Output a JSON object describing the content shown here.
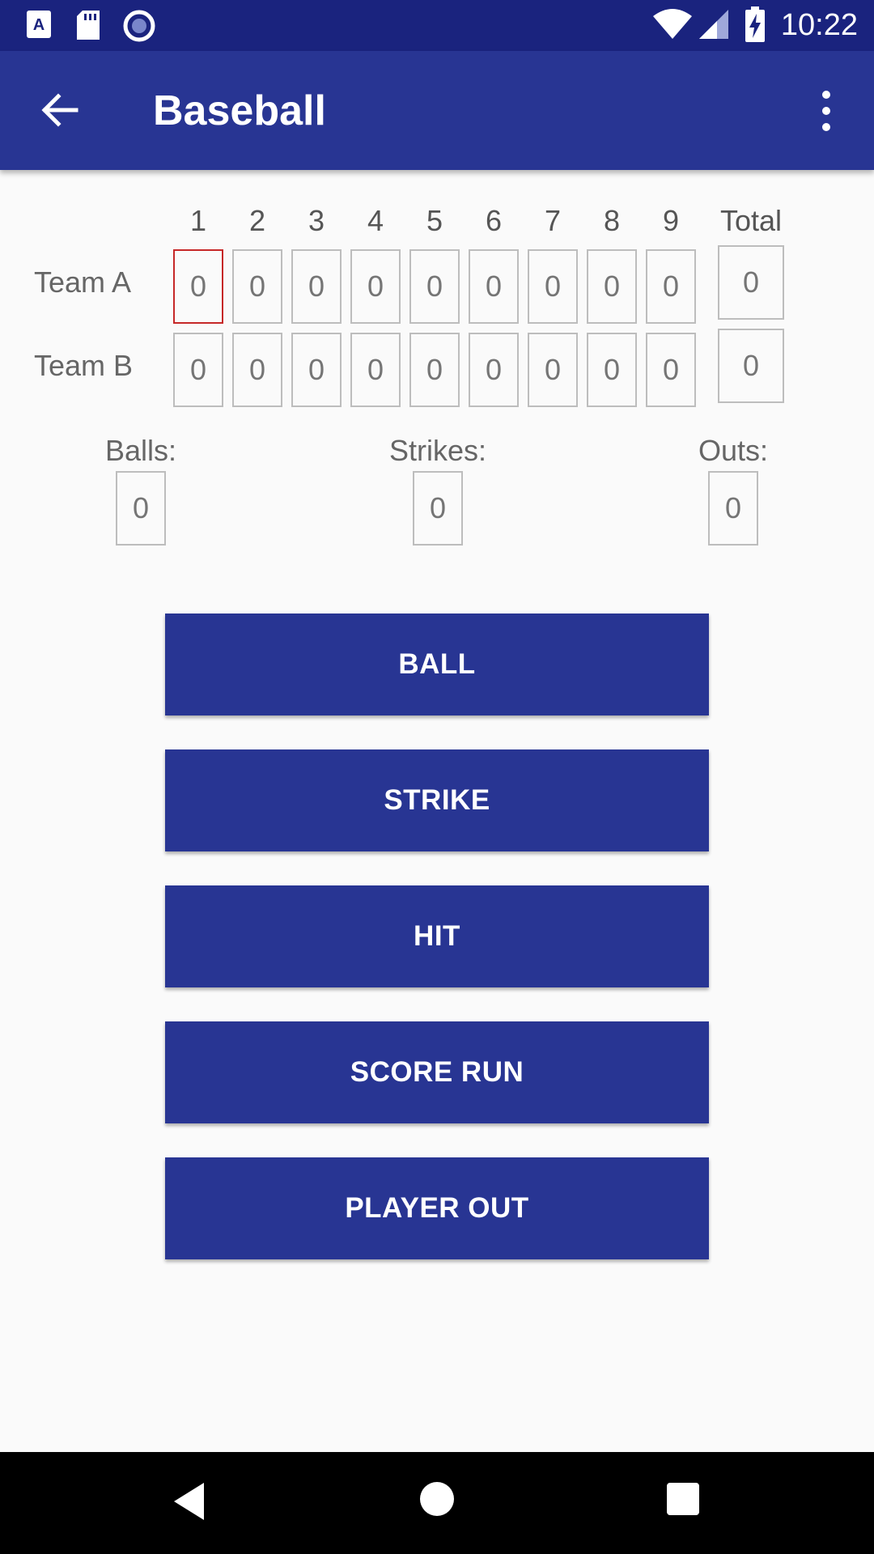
{
  "status_bar": {
    "time": "10:22",
    "icons": [
      "text-notification-icon",
      "sd-card-icon",
      "record-icon",
      "wifi-icon",
      "signal-icon",
      "battery-charging-icon"
    ]
  },
  "app_bar": {
    "title": "Baseball",
    "back_icon": "arrow-back-icon",
    "menu_icon": "more-vert-icon"
  },
  "scoreboard": {
    "innings": [
      "1",
      "2",
      "3",
      "4",
      "5",
      "6",
      "7",
      "8",
      "9"
    ],
    "total_label": "Total",
    "teams": [
      {
        "name": "Team A",
        "scores": [
          "0",
          "0",
          "0",
          "0",
          "0",
          "0",
          "0",
          "0",
          "0"
        ],
        "total": "0"
      },
      {
        "name": "Team B",
        "scores": [
          "0",
          "0",
          "0",
          "0",
          "0",
          "0",
          "0",
          "0",
          "0"
        ],
        "total": "0"
      }
    ]
  },
  "count": {
    "balls_label": "Balls:",
    "balls": "0",
    "strikes_label": "Strikes:",
    "strikes": "0",
    "outs_label": "Outs:",
    "outs": "0"
  },
  "actions": {
    "ball": "BALL",
    "strike": "STRIKE",
    "hit": "HIT",
    "score_run": "SCORE RUN",
    "player_out": "PLAYER OUT"
  },
  "colors": {
    "primary": "#283593",
    "primary_dark": "#1a237e",
    "active_cell_border": "#c62828"
  }
}
